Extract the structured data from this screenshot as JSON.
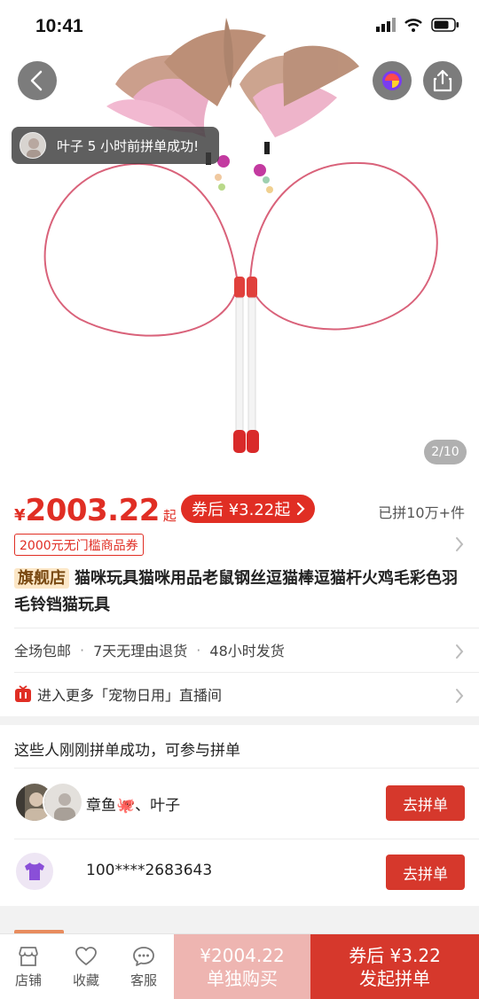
{
  "status_bar": {
    "time": "10:41"
  },
  "toast": {
    "text": "叶子 5 小时前拼单成功!"
  },
  "gallery": {
    "counter": "2/10"
  },
  "price": {
    "currency": "¥",
    "amount": "2003.22",
    "suffix": "起",
    "coupon_pill": "券后 ¥3.22起",
    "sold": "已拼10万+件",
    "coupon_tag": "2000元无门槛商品券"
  },
  "title": {
    "shop_badge": "旗舰店",
    "text": "猫咪玩具猫咪用品老鼠钢丝逗猫棒逗猫杆火鸡毛彩色羽毛铃铛猫玩具"
  },
  "services": {
    "items": [
      "全场包邮",
      "7天无理由退货",
      "48小时发货"
    ],
    "separator": "·"
  },
  "live": {
    "text": "进入更多「宠物日用」直播间"
  },
  "group_buy": {
    "header": "这些人刚刚拼单成功，可参与拼单",
    "rows": [
      {
        "name": "章鱼🐙、叶子",
        "button": "去拼单"
      },
      {
        "name": "100****2683643",
        "button": "去拼单"
      }
    ]
  },
  "bottom_bar": {
    "nav": [
      {
        "label": "店铺",
        "icon": "store-icon"
      },
      {
        "label": "收藏",
        "icon": "heart-icon"
      },
      {
        "label": "客服",
        "icon": "chat-icon"
      }
    ],
    "single_buy": {
      "price": "¥2004.22",
      "label": "单独购买"
    },
    "group_buy": {
      "price": "券后 ¥3.22",
      "label": "发起拼单"
    }
  },
  "colors": {
    "accent": "#e02e24",
    "join_button": "#d6382c",
    "single_buy_bg": "#eeb5b1",
    "shop_badge_bg": "#fce7c7"
  }
}
